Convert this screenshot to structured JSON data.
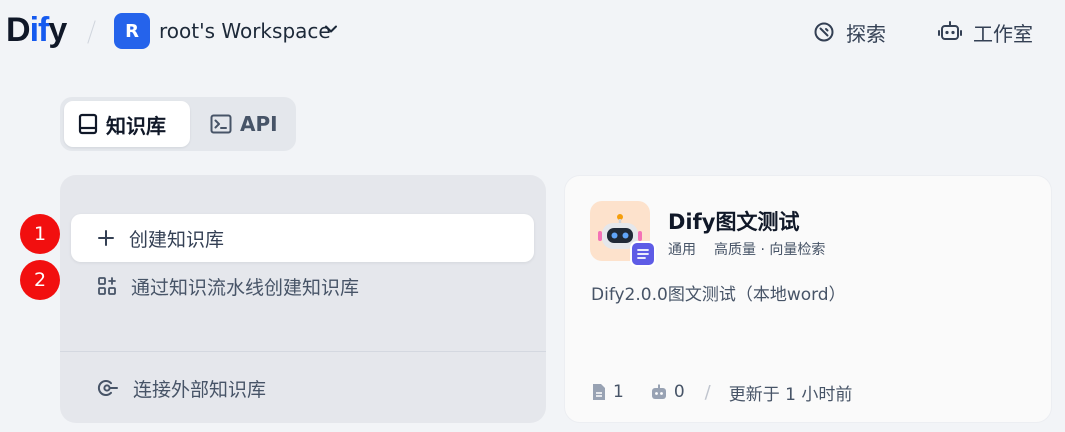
{
  "header": {
    "logo_a": "D",
    "logo_b": "if",
    "logo_c": "y",
    "workspace_initial": "R",
    "workspace_name": "root's Workspace",
    "nav": [
      {
        "label": "探索",
        "icon": "compass-icon"
      },
      {
        "label": "工作室",
        "icon": "robot-icon"
      }
    ]
  },
  "tabs": [
    {
      "label": "知识库",
      "icon": "book-icon",
      "active": true
    },
    {
      "label": "API",
      "icon": "terminal-icon",
      "active": false
    }
  ],
  "create_panel": {
    "create_label": "创建知识库",
    "pipeline_label": "通过知识流水线创建知识库",
    "external_label": "连接外部知识库"
  },
  "badges": [
    "1",
    "2"
  ],
  "dataset_card": {
    "title": "Dify图文测试",
    "tag": "通用",
    "meta": "高质量 · 向量检索",
    "description": "Dify2.0.0图文测试（本地word）",
    "doc_count": "1",
    "app_count": "0",
    "updated": "更新于 1 小时前"
  },
  "colors": {
    "accent": "#155aef",
    "badge": "#f20f0f",
    "background": "#f2f4f7"
  }
}
